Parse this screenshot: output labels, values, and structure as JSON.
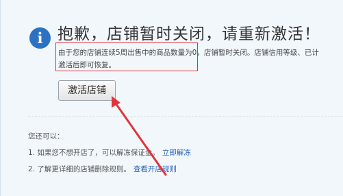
{
  "title": "抱歉，店铺暂时关闭，请重新激活！",
  "icon": {
    "name": "info-icon",
    "glyph": "i",
    "color": "#2d72c2"
  },
  "notice": {
    "line1": "由于您的店铺连续5周出售中的商品数量为0，店铺暂时关闭。店铺信用等级、已计",
    "line2": "激活后即可恢复。"
  },
  "activate_button": "激活店铺",
  "help": {
    "heading": "您还可以：",
    "items": [
      {
        "text": "1. 如果您不想开店了，可以解冻保证金。",
        "link": "立即解冻"
      },
      {
        "text": "2. 了解更详细的店铺删除规则。",
        "link": "查看开店规则"
      }
    ]
  },
  "colors": {
    "background": "#f2f7fc",
    "highlight_box": "#e0343a",
    "arrow": "#e0343a",
    "link": "#2a63b5"
  }
}
